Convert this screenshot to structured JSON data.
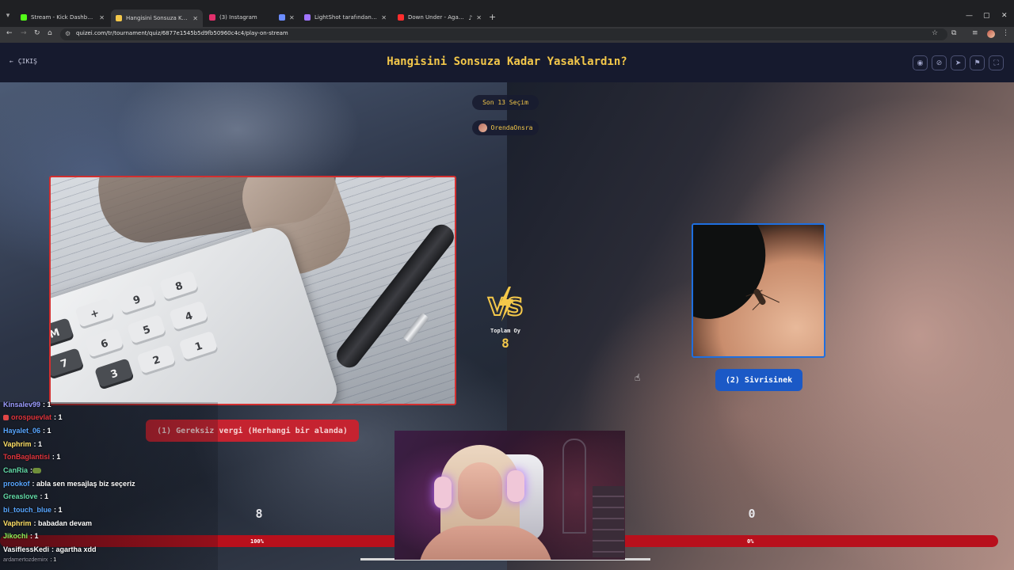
{
  "browser": {
    "tabs": [
      {
        "label": "Stream - Kick Dashboard",
        "favicon_color": "#53fc18"
      },
      {
        "label": "Hangisini Sonsuza Kadar Yasakl",
        "favicon_color": "#f4c84a"
      },
      {
        "label": "(3) Instagram",
        "favicon_color": "#e1306c"
      },
      {
        "label": "",
        "favicon_color": "#6b8cff"
      },
      {
        "label": "LightShot tarafından Ekran Gör",
        "favicon_color": "#a074ff"
      },
      {
        "label": "Down Under - Agartha Rem",
        "favicon_color": "#ff2d2d"
      }
    ],
    "url": "quizei.com/tr/tournament/quiz/6877e1545b5d9fb50960c4c4/play-on-stream"
  },
  "header": {
    "exit_label": "ÇIKIŞ",
    "title": "Hangisini Sonsuza Kadar Yasaklardın?"
  },
  "stage": {
    "round_label": "Son 13 Seçim",
    "host_name": "OrendaOnsra",
    "total_votes_label": "Toplam Oy",
    "total_votes": "8",
    "left_choice": {
      "label": "(1) Gereksiz vergi (Herhangi bir alanda)",
      "votes": "8",
      "percent_label": "100%",
      "percent": 100
    },
    "right_choice": {
      "label": "(2) Sivrisinek",
      "votes": "0",
      "percent_label": "0%",
      "percent": 0
    },
    "colors": {
      "accent": "#f4c84a",
      "left": "#d32f2f",
      "right": "#1e6fe0",
      "bar": "#b8101c"
    }
  },
  "chat": {
    "messages": [
      {
        "user": "Kinsalev99",
        "text": ": 1",
        "color": "#9c9cff"
      },
      {
        "user": "orospuevlat",
        "text": ": 1",
        "color": "#e0343c"
      },
      {
        "user": "Hayalet_06",
        "text": ": 1",
        "color": "#58a6ff"
      },
      {
        "user": "Vaphrim",
        "text": ": 1",
        "color": "#ffe066"
      },
      {
        "user": "TonBaglantisi",
        "text": ": 1",
        "color": "#e0343c"
      },
      {
        "user": "CanRia",
        "text": ":",
        "color": "#62d9a6"
      },
      {
        "user": "prookof",
        "text": ": abla sen mesajlaş biz seçeriz",
        "color": "#58a6ff"
      },
      {
        "user": "Greaslove",
        "text": ": 1",
        "color": "#62d9a6"
      },
      {
        "user": "bi_touch_blue",
        "text": ": 1",
        "color": "#58a6ff"
      },
      {
        "user": "Vaphrim",
        "text": ": babadan devam",
        "color": "#ffe066"
      },
      {
        "user": "Jikochi",
        "text": ": 1",
        "color": "#8cf05a"
      },
      {
        "user": "VasiflessKedi",
        "text": ": agartha xdd",
        "color": "#ffffff"
      },
      {
        "user": "ardamertozdemirx",
        "text": ": 1",
        "color": "#9a9aa8"
      }
    ]
  }
}
